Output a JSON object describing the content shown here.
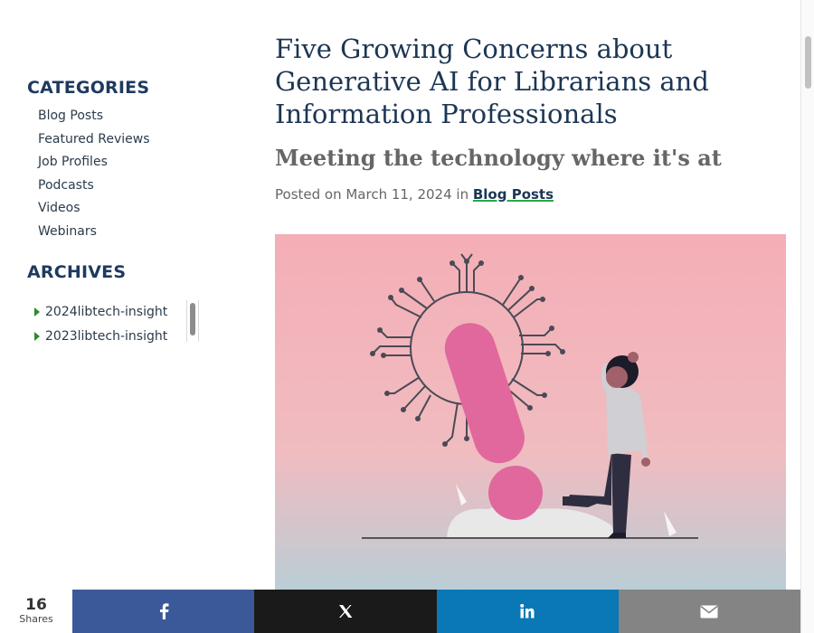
{
  "sidebar": {
    "categories_heading": "CATEGORIES",
    "categories": [
      {
        "label": "Blog Posts"
      },
      {
        "label": "Featured Reviews"
      },
      {
        "label": "Job Profiles"
      },
      {
        "label": "Podcasts"
      },
      {
        "label": "Videos"
      },
      {
        "label": "Webinars"
      }
    ],
    "archives_heading": "ARCHIVES",
    "archives": [
      {
        "label": "2024libtech-insight"
      },
      {
        "label": "2023libtech-insight"
      }
    ]
  },
  "article": {
    "title": "Five Growing Concerns about Generative AI for Librarians and Information Professionals",
    "subtitle": "Meeting the technology where it's at",
    "meta_prefix": "Posted on March 11, 2024 in ",
    "category_link": "Blog Posts",
    "hero_image": "exclamation-mark-illustration"
  },
  "share": {
    "count": "16",
    "count_label": "Shares",
    "buttons": [
      {
        "network": "facebook",
        "icon": "facebook-icon",
        "color": "#3b5998"
      },
      {
        "network": "twitter",
        "icon": "twitter-icon",
        "color": "#1a1a1a"
      },
      {
        "network": "linkedin",
        "icon": "linkedin-icon",
        "color": "#0a78b5"
      },
      {
        "network": "email",
        "icon": "email-icon",
        "color": "#848484"
      }
    ]
  },
  "colors": {
    "heading": "#1c3654",
    "accent_underline": "#2aa84a",
    "hero_pink": "#f4aeb6",
    "exclamation": "#e0689c"
  }
}
